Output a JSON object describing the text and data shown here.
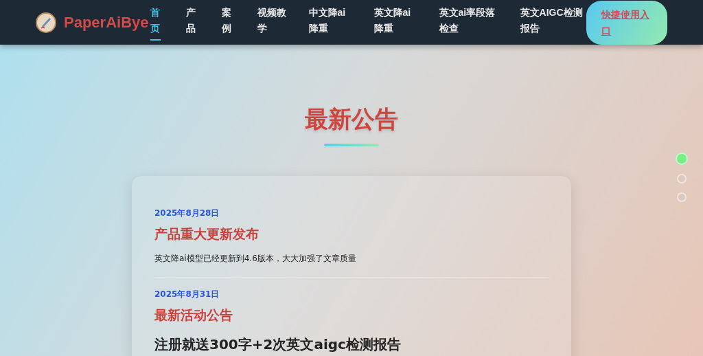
{
  "brand": {
    "name": "PaperAiBye"
  },
  "nav": [
    {
      "label": "首页",
      "selected": true
    },
    {
      "label": "产品",
      "selected": false
    },
    {
      "label": "案例",
      "selected": false
    },
    {
      "label": "视频教学",
      "selected": false
    },
    {
      "label": "中文降ai降重",
      "selected": false
    },
    {
      "label": "英文降ai降重",
      "selected": false
    },
    {
      "label": "英文ai率段落检查",
      "selected": false
    },
    {
      "label": "英文AIGC检测报告",
      "selected": false
    }
  ],
  "cta": {
    "label": "快捷使用入口"
  },
  "section": {
    "title": "最新公告"
  },
  "announcements": [
    {
      "date": "2025年8月28日",
      "title": "产品重大更新发布",
      "body": "英文降ai模型已经更新到4.6版本，大大加强了文章质量",
      "kind": "normal"
    },
    {
      "date": "2025年8月31日",
      "title": "最新活动公告",
      "body": "注册就送300字+2次英文aigc检测报告",
      "kind": "headline"
    }
  ],
  "dots": [
    {
      "selected": true
    },
    {
      "selected": false
    },
    {
      "selected": false
    }
  ]
}
